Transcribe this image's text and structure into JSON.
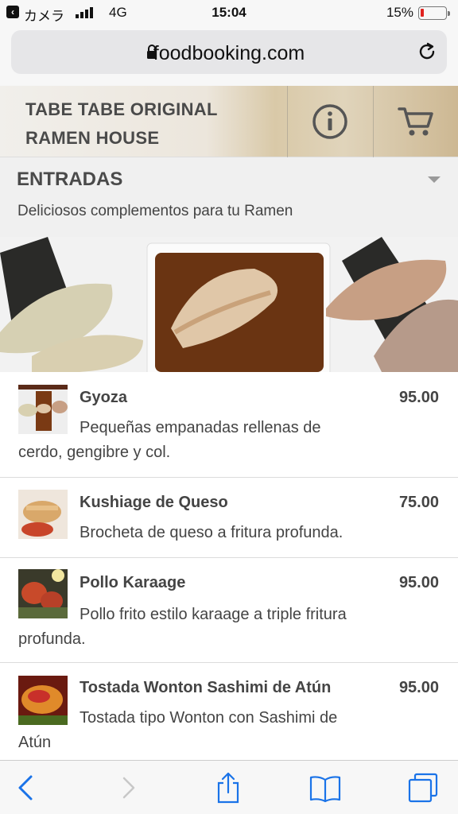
{
  "status_bar": {
    "carrier": "カメラ",
    "network": "4G",
    "time": "15:04",
    "battery_pct": "15%",
    "battery_color": "#e0221f"
  },
  "browser": {
    "url": "foodbooking.com",
    "lock_icon": "lock-icon",
    "reload_icon": "reload-icon"
  },
  "header": {
    "title_line1": "TABE TABE ORIGINAL",
    "title_line2": "RAMEN HOUSE",
    "info_icon": "info-icon",
    "cart_icon": "cart-icon"
  },
  "section": {
    "heading": "ENTRADAS",
    "subtitle": "Deliciosos complementos para tu Ramen"
  },
  "items": [
    {
      "name": "Gyoza",
      "price": "95.00",
      "desc": "Pequeñas empanadas rellenas de cerdo, gengibre y col."
    },
    {
      "name": "Kushiage de Queso",
      "price": "75.00",
      "desc": "Brocheta de queso a fritura profunda."
    },
    {
      "name": "Pollo Karaage",
      "price": "95.00",
      "desc": "Pollo frito estilo karaage a triple fritura profunda."
    },
    {
      "name": "Tostada Wonton Sashimi de Atún",
      "price": "95.00",
      "desc": "Tostada tipo Wonton con Sashimi de Atún"
    }
  ],
  "toolbar": {
    "icons": [
      "back-icon",
      "forward-icon",
      "share-icon",
      "bookmarks-icon",
      "tabs-icon"
    ],
    "accent": "#1a73e8"
  }
}
